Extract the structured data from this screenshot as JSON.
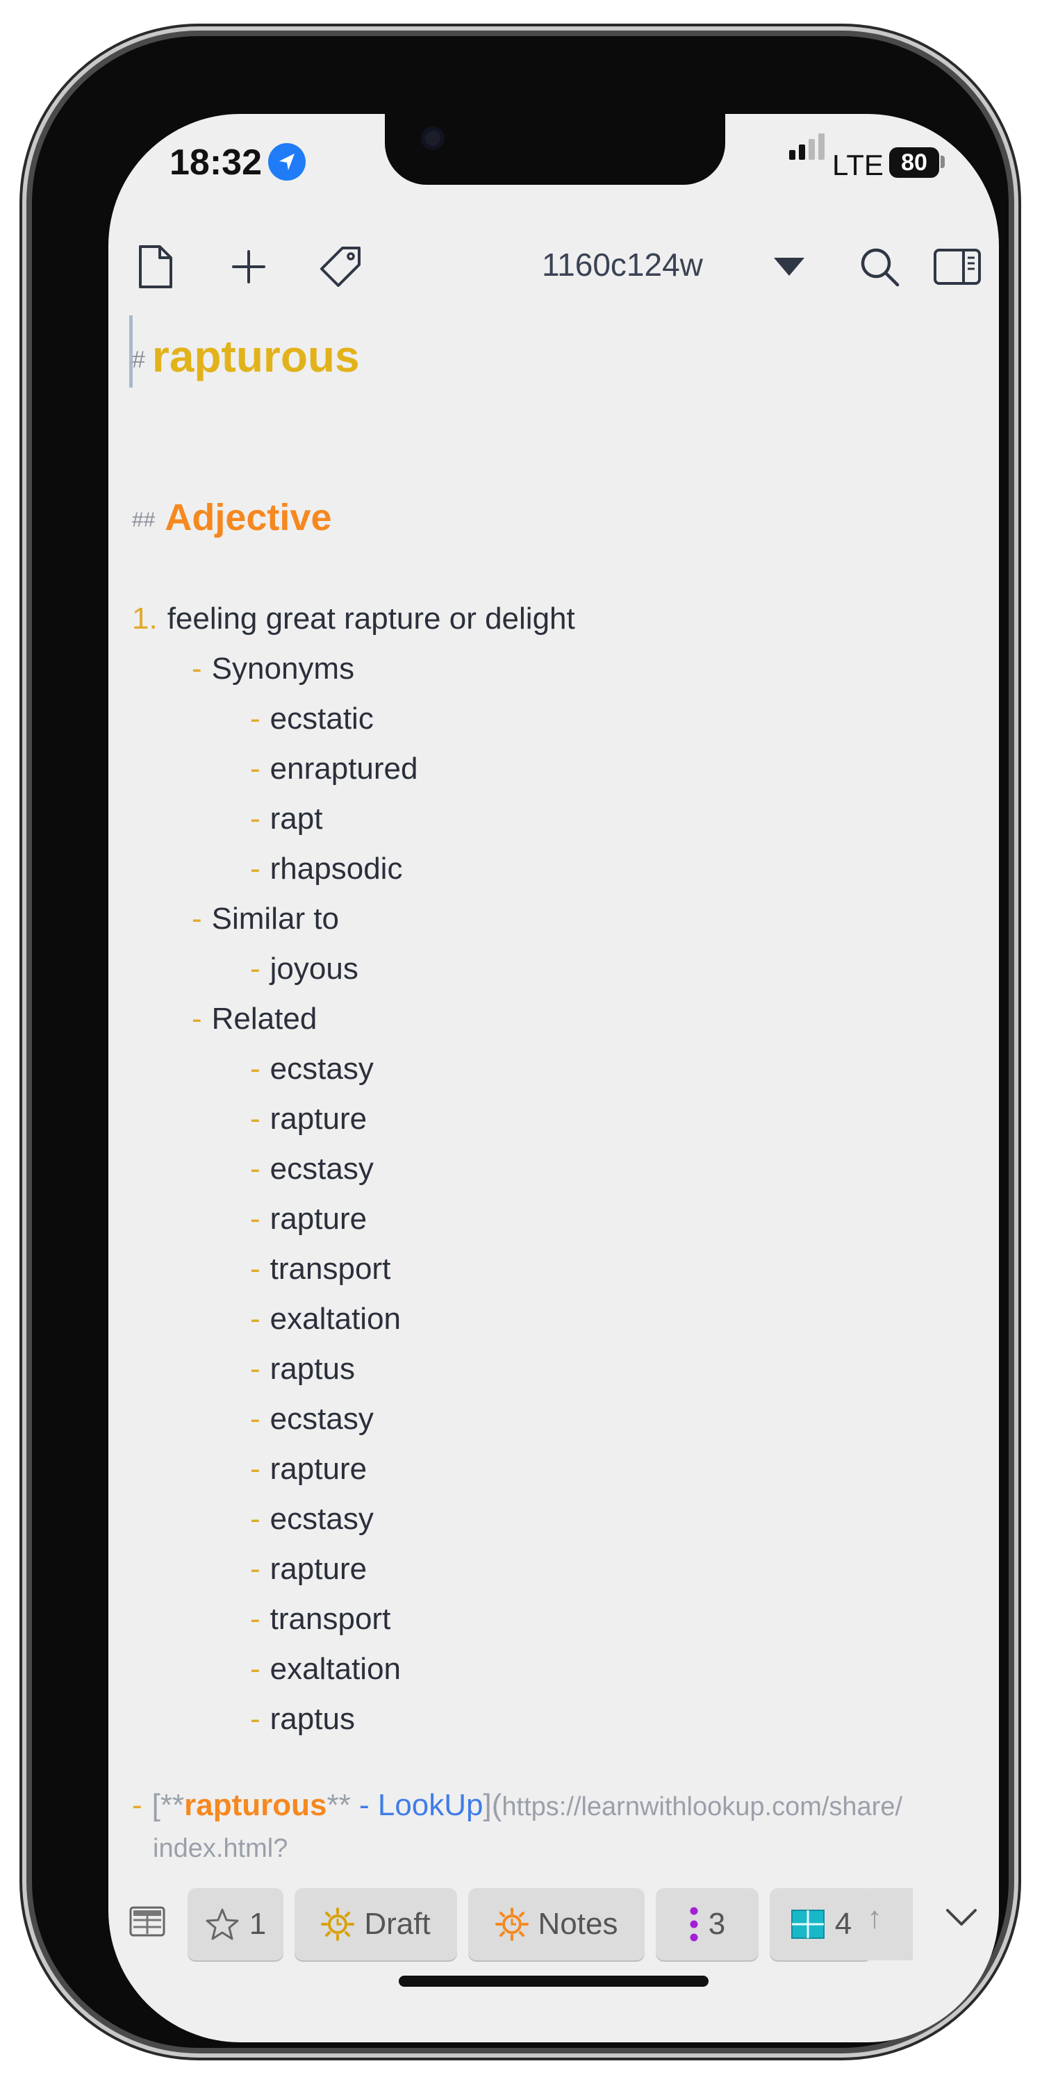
{
  "status": {
    "time": "18:32",
    "network": "LTE",
    "battery": "80"
  },
  "toolbar": {
    "icons": [
      "new-document-icon",
      "plus-icon",
      "tag-icon",
      "dropdown-caret-icon",
      "search-icon",
      "sidebar-toggle-icon"
    ],
    "title": "1160c124w"
  },
  "note": {
    "h1_mark": "#",
    "h1": "rapturous",
    "h2_mark": "##",
    "h2": "Adjective",
    "dash": "-",
    "definition_number": "1.",
    "definition": "feeling great rapture or delight",
    "sections": [
      {
        "label": "Synonyms",
        "items": [
          "ecstatic",
          "enraptured",
          "rapt",
          "rhapsodic"
        ]
      },
      {
        "label": "Similar to",
        "items": [
          "joyous"
        ]
      },
      {
        "label": "Related",
        "items": [
          "ecstasy",
          "rapture",
          "ecstasy",
          "rapture",
          "transport",
          "exaltation",
          "raptus",
          "ecstasy",
          "rapture",
          "ecstasy",
          "rapture",
          "transport",
          "exaltation",
          "raptus"
        ]
      }
    ],
    "link": {
      "dash": "-",
      "open": "[**",
      "bold_word": "rapturous",
      "close_bold": "**",
      "text": " - LookUp",
      "close": "](",
      "url": "https://learnwithlookup.com/share/",
      "url_cont": "index.html?"
    }
  },
  "chips": [
    {
      "icon": "star-icon",
      "label": "1",
      "color": "#666666"
    },
    {
      "icon": "sun-icon",
      "label": "Draft",
      "color": "#d8a10c"
    },
    {
      "icon": "sun-icon",
      "label": "Notes",
      "color": "#f5881f"
    },
    {
      "icon": "vertical-dots-icon",
      "label": "3",
      "color": "#a21fd6"
    },
    {
      "icon": "table-icon",
      "label": "4",
      "color": "#19b8c9"
    }
  ]
}
